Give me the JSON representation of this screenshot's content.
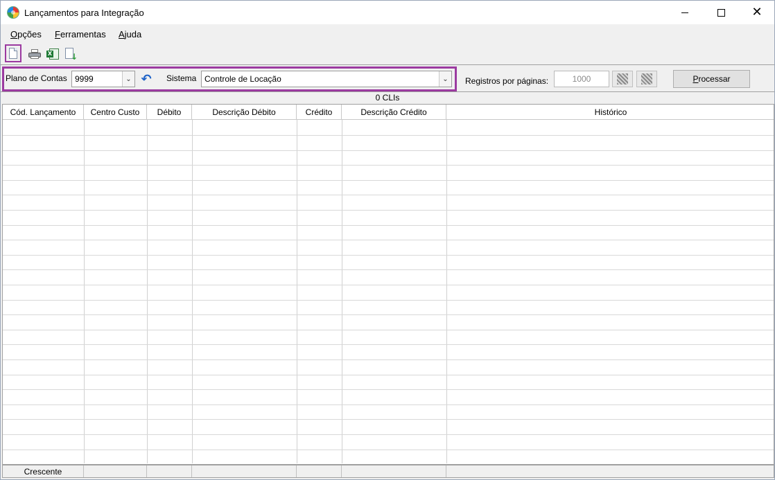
{
  "window": {
    "title": "Lançamentos para Integração",
    "min_label": "",
    "max_label": "",
    "close_glyph": "✕"
  },
  "menu": {
    "items": [
      {
        "underline": "O",
        "rest": "pções"
      },
      {
        "underline": "F",
        "rest": "erramentas"
      },
      {
        "underline": "A",
        "rest": "juda"
      }
    ]
  },
  "toolbar": {
    "icons": [
      "new-document-icon",
      "print-icon",
      "excel-export-icon",
      "export-download-icon"
    ]
  },
  "filters": {
    "plano_label": "Plano de Contas",
    "plano_value": "9999",
    "sistema_label": "Sistema",
    "sistema_value": "Controle de Locação",
    "registros_label": "Registros por páginas:",
    "registros_value": "1000",
    "processar_underline": "P",
    "processar_rest": "rocessar",
    "highlight_color": "#9b3aa0"
  },
  "grid": {
    "count_text": "0 CLIs",
    "columns": [
      "Cód. Lançamento",
      "Centro Custo",
      "Débito",
      "Descrição Débito",
      "Crédito",
      "Descrição Crédito",
      "Histórico"
    ],
    "rows": [],
    "footer_first": "Crescente"
  }
}
